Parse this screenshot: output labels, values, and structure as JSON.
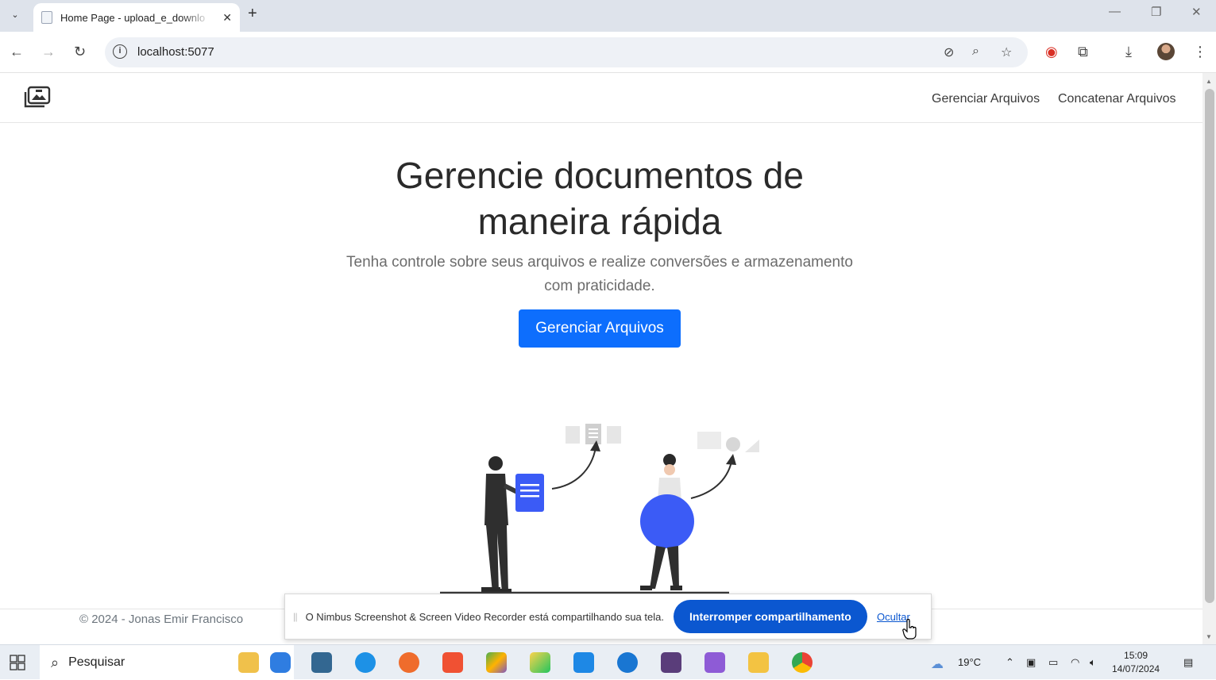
{
  "browser": {
    "tab_title": "Home Page - upload_e_downlo",
    "url": "localhost:5077"
  },
  "navbar": {
    "links": [
      "Gerenciar Arquivos",
      "Concatenar Arquivos"
    ]
  },
  "hero": {
    "title_line1": "Gerencie documentos de",
    "title_line2": "maneira rápida",
    "lead_line1": "Tenha controle sobre seus arquivos e realize conversões e armazenamento",
    "lead_line2": "com praticidade.",
    "button": "Gerenciar Arquivos"
  },
  "footer": {
    "text": "© 2024 - Jonas Emir Francisco"
  },
  "sharebar": {
    "message": "O Nimbus Screenshot & Screen Video Recorder está compartilhando sua tela.",
    "stop_button": "Interromper compartilhamento",
    "hide_link": "Ocultar"
  },
  "taskbar": {
    "search_text": "Pesquisar",
    "weather": "19°C",
    "time": "15:09",
    "date": "14/07/2024"
  },
  "colors": {
    "primary": "#0d6efd",
    "share_button": "#0b57d0",
    "illustration_accent": "#3b5bf6"
  }
}
